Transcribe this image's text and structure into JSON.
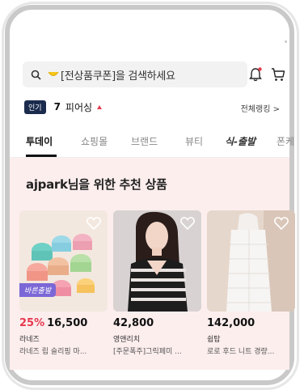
{
  "search": {
    "text": "[전상품쿠폰]을 검색하세요"
  },
  "popular": {
    "badge": "인기",
    "rank": "7",
    "keyword": "피어싱",
    "ranking_link": "전체랭킹 >"
  },
  "tabs": [
    {
      "label": "투데이",
      "active": true
    },
    {
      "label": "쇼핑몰",
      "active": false
    },
    {
      "label": "브랜드",
      "active": false
    },
    {
      "label": "뷰티",
      "active": false
    },
    {
      "label": "식-출발",
      "active": false
    },
    {
      "label": "폰케",
      "active": false
    }
  ],
  "recommend": {
    "title": "ajpark님을 위한 추천 상품",
    "products": [
      {
        "discount": "25%",
        "price": "16,500",
        "brand": "라네즈",
        "name": "라네즈 립 슬리핑 마...",
        "badge": "바른출발"
      },
      {
        "discount": "",
        "price": "42,800",
        "brand": "영앤리치",
        "name": "[주문폭주]그릭페미 ...",
        "badge": ""
      },
      {
        "discount": "",
        "price": "142,000",
        "brand": "쉽탑",
        "name": "로로 후드 니트 경량...",
        "badge": ""
      }
    ]
  },
  "colors": {
    "accent": "#e5394d",
    "hot_badge": "#1a2b4d",
    "rec_bg": "#fdeeee"
  }
}
